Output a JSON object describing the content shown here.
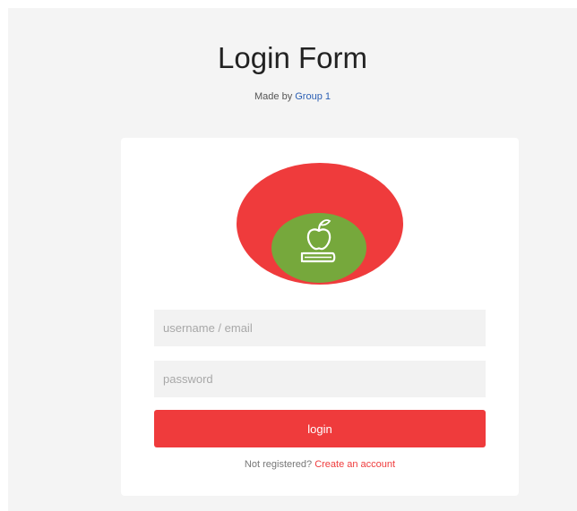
{
  "header": {
    "title": "Login Form",
    "subtitle_prefix": "Made by ",
    "subtitle_group": "Group 1"
  },
  "logo": {
    "icon": "apple-on-book-icon",
    "outer_color": "#ef3b3c",
    "inner_color": "#76a83c"
  },
  "form": {
    "username_placeholder": "username / email",
    "username_value": "",
    "password_placeholder": "password",
    "password_value": "",
    "login_label": "login",
    "register_prompt": "Not registered? ",
    "register_link": "Create an account"
  },
  "colors": {
    "accent": "#ef3b3c",
    "page_background": "#f4f4f4",
    "card_background": "#ffffff",
    "field_background": "#f2f2f2"
  }
}
